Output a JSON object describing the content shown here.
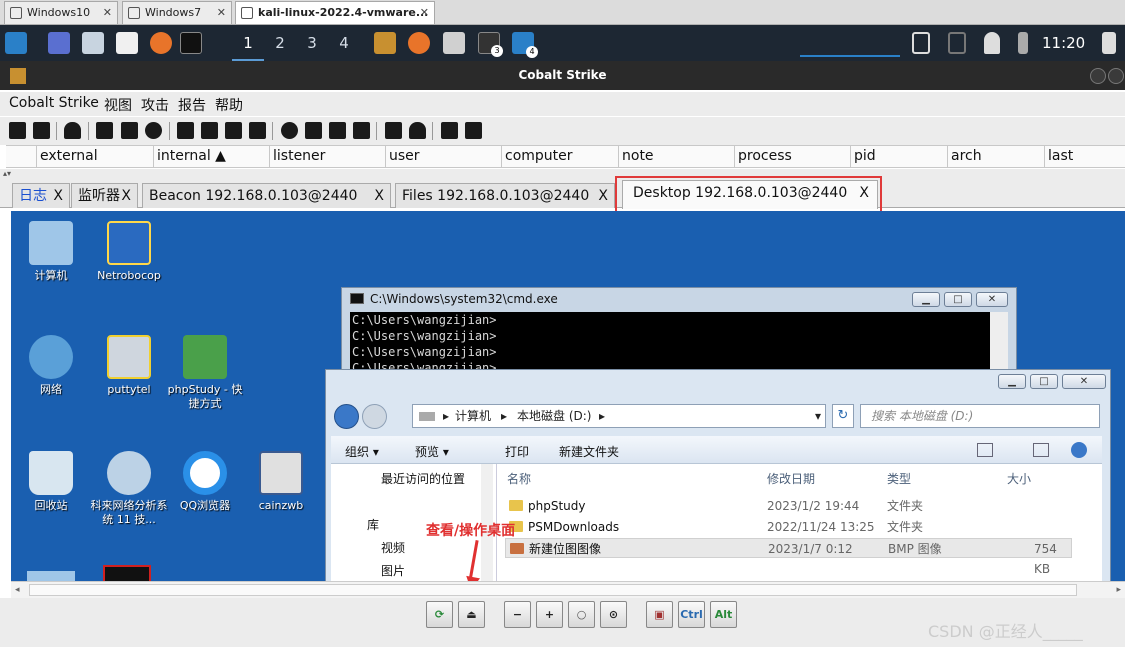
{
  "vm_tabs": [
    {
      "label": "Windows10",
      "close": "✕"
    },
    {
      "label": "Windows7",
      "close": "✕"
    },
    {
      "label": "kali-linux-2022.4-vmware...",
      "close": "✕"
    }
  ],
  "kali_panel": {
    "workspaces": [
      "1",
      "2",
      "3",
      "4"
    ],
    "badges": [
      "3",
      "4"
    ],
    "clock": "11:20"
  },
  "app": {
    "title": "Cobalt Strike",
    "menu": [
      "Cobalt Strike",
      "视图",
      "攻击",
      "报告",
      "帮助"
    ]
  },
  "table_columns": [
    "external",
    "internal ▲",
    "listener",
    "user",
    "computer",
    "note",
    "process",
    "pid",
    "arch",
    "last"
  ],
  "tabs": [
    {
      "label": "日志",
      "close": "X"
    },
    {
      "label": "监听器",
      "close": "X"
    },
    {
      "label": "Beacon 192.168.0.103@2440",
      "close": "X"
    },
    {
      "label": "Files 192.168.0.103@2440",
      "close": "X"
    },
    {
      "label": "Desktop 192.168.0.103@2440",
      "close": "X"
    }
  ],
  "desktop": {
    "icons": [
      "计算机",
      "Netrobocop",
      "网络",
      "puttytel",
      "phpStudy - 快捷方式",
      "回收站",
      "科来网络分析系统 11 技...",
      "QQ浏览器",
      "cainzwb"
    ],
    "cmd": {
      "title": "C:\\Windows\\system32\\cmd.exe",
      "lines": [
        "C:\\Users\\wangzijian>",
        "C:\\Users\\wangzijian>",
        "C:\\Users\\wangzijian>",
        "C:\\Users\\wangzijian>"
      ]
    },
    "explorer": {
      "breadcrumb": [
        "计算机",
        "本地磁盘 (D:)"
      ],
      "search_placeholder": "搜索 本地磁盘 (D:)",
      "toolbar": [
        "组织 ▾",
        "预览 ▾",
        "打印",
        "新建文件夹"
      ],
      "nav": [
        "最近访问的位置",
        "库",
        "视频",
        "图片"
      ],
      "columns": [
        "名称",
        "修改日期",
        "类型",
        "大小"
      ],
      "files": [
        {
          "name": "phpStudy",
          "date": "2023/1/2 19:44",
          "type": "文件夹",
          "size": ""
        },
        {
          "name": "PSMDownloads",
          "date": "2022/11/24 13:25",
          "type": "文件夹",
          "size": ""
        },
        {
          "name": "新建位图图像",
          "date": "2023/1/7 0:12",
          "type": "BMP 图像",
          "size": "754 KB"
        }
      ]
    }
  },
  "annotation": "查看/操作桌面",
  "bottom_buttons": [
    "Ctrl",
    "Alt"
  ],
  "watermark": "CSDN @正经人_____",
  "colors": {
    "accent_red": "#e03a3a",
    "desktop_blue": "#1a5fb0",
    "panel_dark": "#1d2733"
  }
}
